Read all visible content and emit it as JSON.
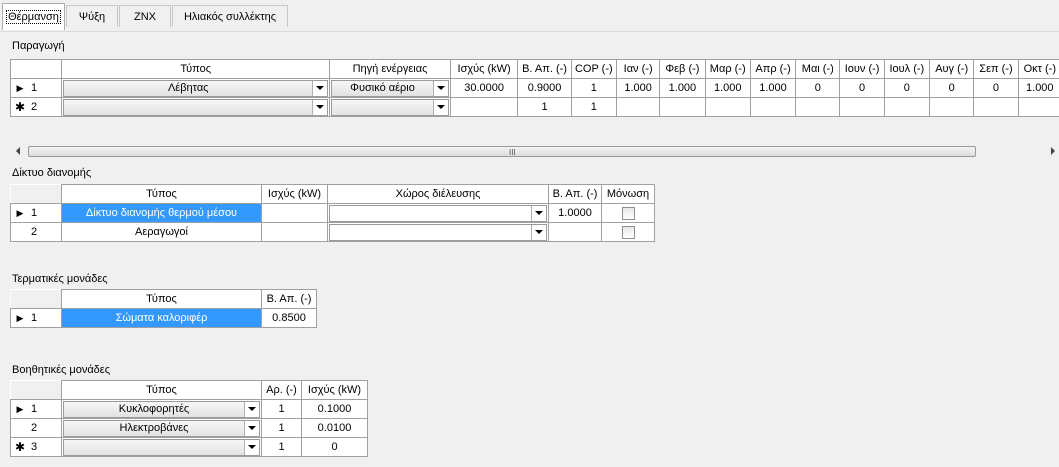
{
  "tabs": [
    {
      "label": "Θέρμανση",
      "active": true
    },
    {
      "label": "Ψύξη",
      "active": false
    },
    {
      "label": "ZNX",
      "active": false
    },
    {
      "label": "Ηλιακός συλλέκτης",
      "active": false
    }
  ],
  "production": {
    "label": "Παραγωγή",
    "headers": [
      "Τύπος",
      "Πηγή ενέργειας",
      "Ισχύς (kW)",
      "Β. Απ. (-)",
      "COP (-)",
      "Ιαν (-)",
      "Φεβ (-)",
      "Μαρ (-)",
      "Απρ (-)",
      "Μαι (-)",
      "Ιουν (-)",
      "Ιουλ (-)",
      "Αυγ (-)",
      "Σεπ (-)",
      "Οκτ (-)"
    ],
    "rows": [
      {
        "marker": "▶",
        "num": "1",
        "type": "Λέβητας",
        "source": "Φυσικό αέριο",
        "values": [
          "30.0000",
          "0.9000",
          "1",
          "1.000",
          "1.000",
          "1.000",
          "1.000",
          "0",
          "0",
          "0",
          "0",
          "0",
          "1.000"
        ]
      },
      {
        "marker": "✱",
        "num": "2",
        "type": "",
        "source": "",
        "values": [
          "",
          "1",
          "1",
          "",
          "",
          "",
          "",
          "",
          "",
          "",
          "",
          "",
          ""
        ]
      }
    ]
  },
  "distribution": {
    "label": "Δίκτυο διανομής",
    "headers": [
      "Τύπος",
      "Ισχύς (kW)",
      "Χώρος διέλευσης",
      "Β. Απ. (-)",
      "Μόνωση"
    ],
    "rows": [
      {
        "marker": "▶",
        "num": "1",
        "type": "Δίκτυο διανομής θερμού μέσου",
        "power": "",
        "space": "",
        "eff": "1.0000",
        "insulation": false
      },
      {
        "marker": "",
        "num": "2",
        "type": "Αεραγωγοί",
        "power": "",
        "space": "",
        "eff": "",
        "insulation": false
      }
    ]
  },
  "terminal": {
    "label": "Τερματικές μονάδες",
    "headers": [
      "Τύπος",
      "Β. Απ. (-)"
    ],
    "rows": [
      {
        "marker": "▶",
        "num": "1",
        "type": "Σώματα καλοριφέρ",
        "eff": "0.8500"
      }
    ]
  },
  "auxiliary": {
    "label": "Βοηθητικές μονάδες",
    "headers": [
      "Τύπος",
      "Αρ. (-)",
      "Ισχύς (kW)"
    ],
    "rows": [
      {
        "marker": "▶",
        "num": "1",
        "type": "Κυκλοφορητές",
        "count": "1",
        "power": "0.1000"
      },
      {
        "marker": "",
        "num": "2",
        "type": "Ηλεκτροβάνες",
        "count": "1",
        "power": "0.0100"
      },
      {
        "marker": "✱",
        "num": "3",
        "type": "",
        "count": "1",
        "power": "0"
      }
    ]
  },
  "scrollbar": {
    "grip": "III"
  },
  "colors": {
    "selection": "#3399ff",
    "background": "#f0f0f0"
  }
}
